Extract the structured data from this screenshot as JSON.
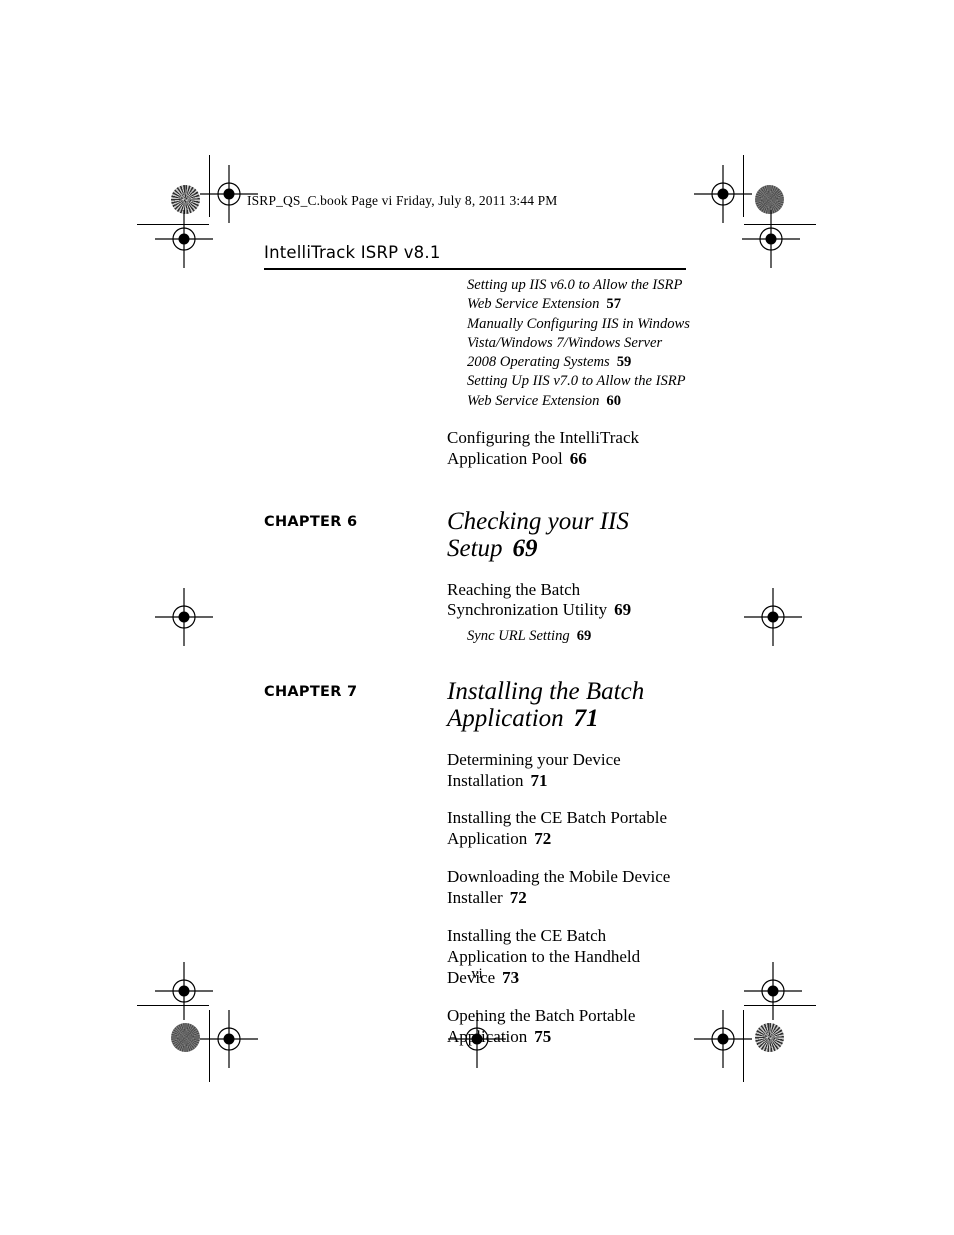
{
  "document": {
    "slug_line": "ISRP_QS_C.book  Page vi  Friday, July 8, 2011  3:44 PM",
    "running_head": "IntelliTrack ISRP v8.1",
    "folio": "vi"
  },
  "toc": {
    "top_subentries": [
      {
        "text": "Setting up IIS v6.0 to Allow the ISRP Web Service Extension",
        "page": "57"
      },
      {
        "text": "Manually Configuring IIS in Windows Vista/Windows 7/Windows Server 2008 Operating Systems",
        "page": "59"
      },
      {
        "text": "Setting Up IIS v7.0 to Allow the ISRP Web Service Extension",
        "page": "60"
      }
    ],
    "top_entries": [
      {
        "text": "Configuring the IntelliTrack Application Pool",
        "page": "66"
      }
    ],
    "chapters": [
      {
        "label": "CHAPTER 6",
        "title": "Checking your IIS Setup",
        "page": "69",
        "entries": [
          {
            "text": "Reaching the Batch Synchronization Utility",
            "page": "69",
            "level": 1
          },
          {
            "text": "Sync URL Setting",
            "page": "69",
            "level": 2
          }
        ]
      },
      {
        "label": "CHAPTER 7",
        "title": "Installing the Batch Application",
        "page": "71",
        "entries": [
          {
            "text": "Determining your Device Installation",
            "page": "71",
            "level": 1
          },
          {
            "text": "Installing the CE Batch Portable Application",
            "page": "72",
            "level": 1
          },
          {
            "text": "Downloading the Mobile Device Installer",
            "page": "72",
            "level": 1
          },
          {
            "text": "Installing the CE Batch Application to the Handheld Device",
            "page": "73",
            "level": 1
          },
          {
            "text": "Opening the Batch Portable Application",
            "page": "75",
            "level": 1
          }
        ]
      }
    ]
  },
  "print_marks": {
    "registration_icon": "registration-target",
    "halftone_burst_icon": "halftone-burst-circle",
    "halftone_solid_icon": "halftone-solid-circle"
  }
}
